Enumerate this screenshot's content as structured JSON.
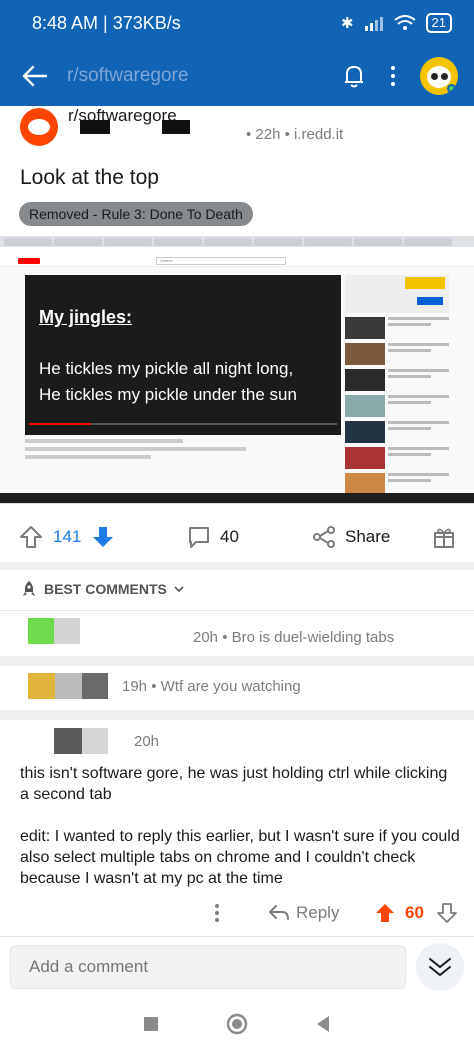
{
  "status_bar": {
    "time": "8:48 AM | 373KB/s",
    "battery": "21"
  },
  "top_bar": {
    "subreddit": "r/softwaregore"
  },
  "post": {
    "subreddit": "r/softwaregore",
    "meta": "• 22h • i.redd.it",
    "title": "Look at the top",
    "removed_badge": "Removed - Rule 3: Done To Death",
    "image": {
      "search_placeholder": "Search",
      "video_heading": "My jingles:",
      "video_line1": "He tickles my pickle all night long,",
      "video_line2": "He tickles my pickle under the sun"
    },
    "upvotes": "141",
    "comments": "40",
    "share_label": "Share"
  },
  "sort_label": "BEST COMMENTS",
  "comments_collapsed": [
    {
      "meta": "20h • Bro is duel-wielding tabs",
      "colors": [
        "#6fdc4e",
        "#d4d4d4"
      ]
    },
    {
      "meta": "19h • Wtf are you watching",
      "colors": [
        "#e0b43a",
        "#bcbcbc",
        "#6a6a6a"
      ]
    }
  ],
  "expanded_comment": {
    "meta": "20h",
    "colors": [
      "#5b5b5b",
      "#d6d6d6"
    ],
    "paragraph1": "this isn't software gore, he was just holding ctrl while clicking a second tab",
    "paragraph2": "edit: I wanted to reply this earlier, but I wasn't sure if you could also select multiple tabs on chrome and I couldn't check because I wasn't at my pc at the time",
    "reply_label": "Reply",
    "score": "60"
  },
  "composer": {
    "placeholder": "Add a comment"
  },
  "colors": {
    "brand_blue": "#1163b6",
    "upvote_orange": "#ff4500",
    "downvote_blue": "#1e7be6"
  }
}
